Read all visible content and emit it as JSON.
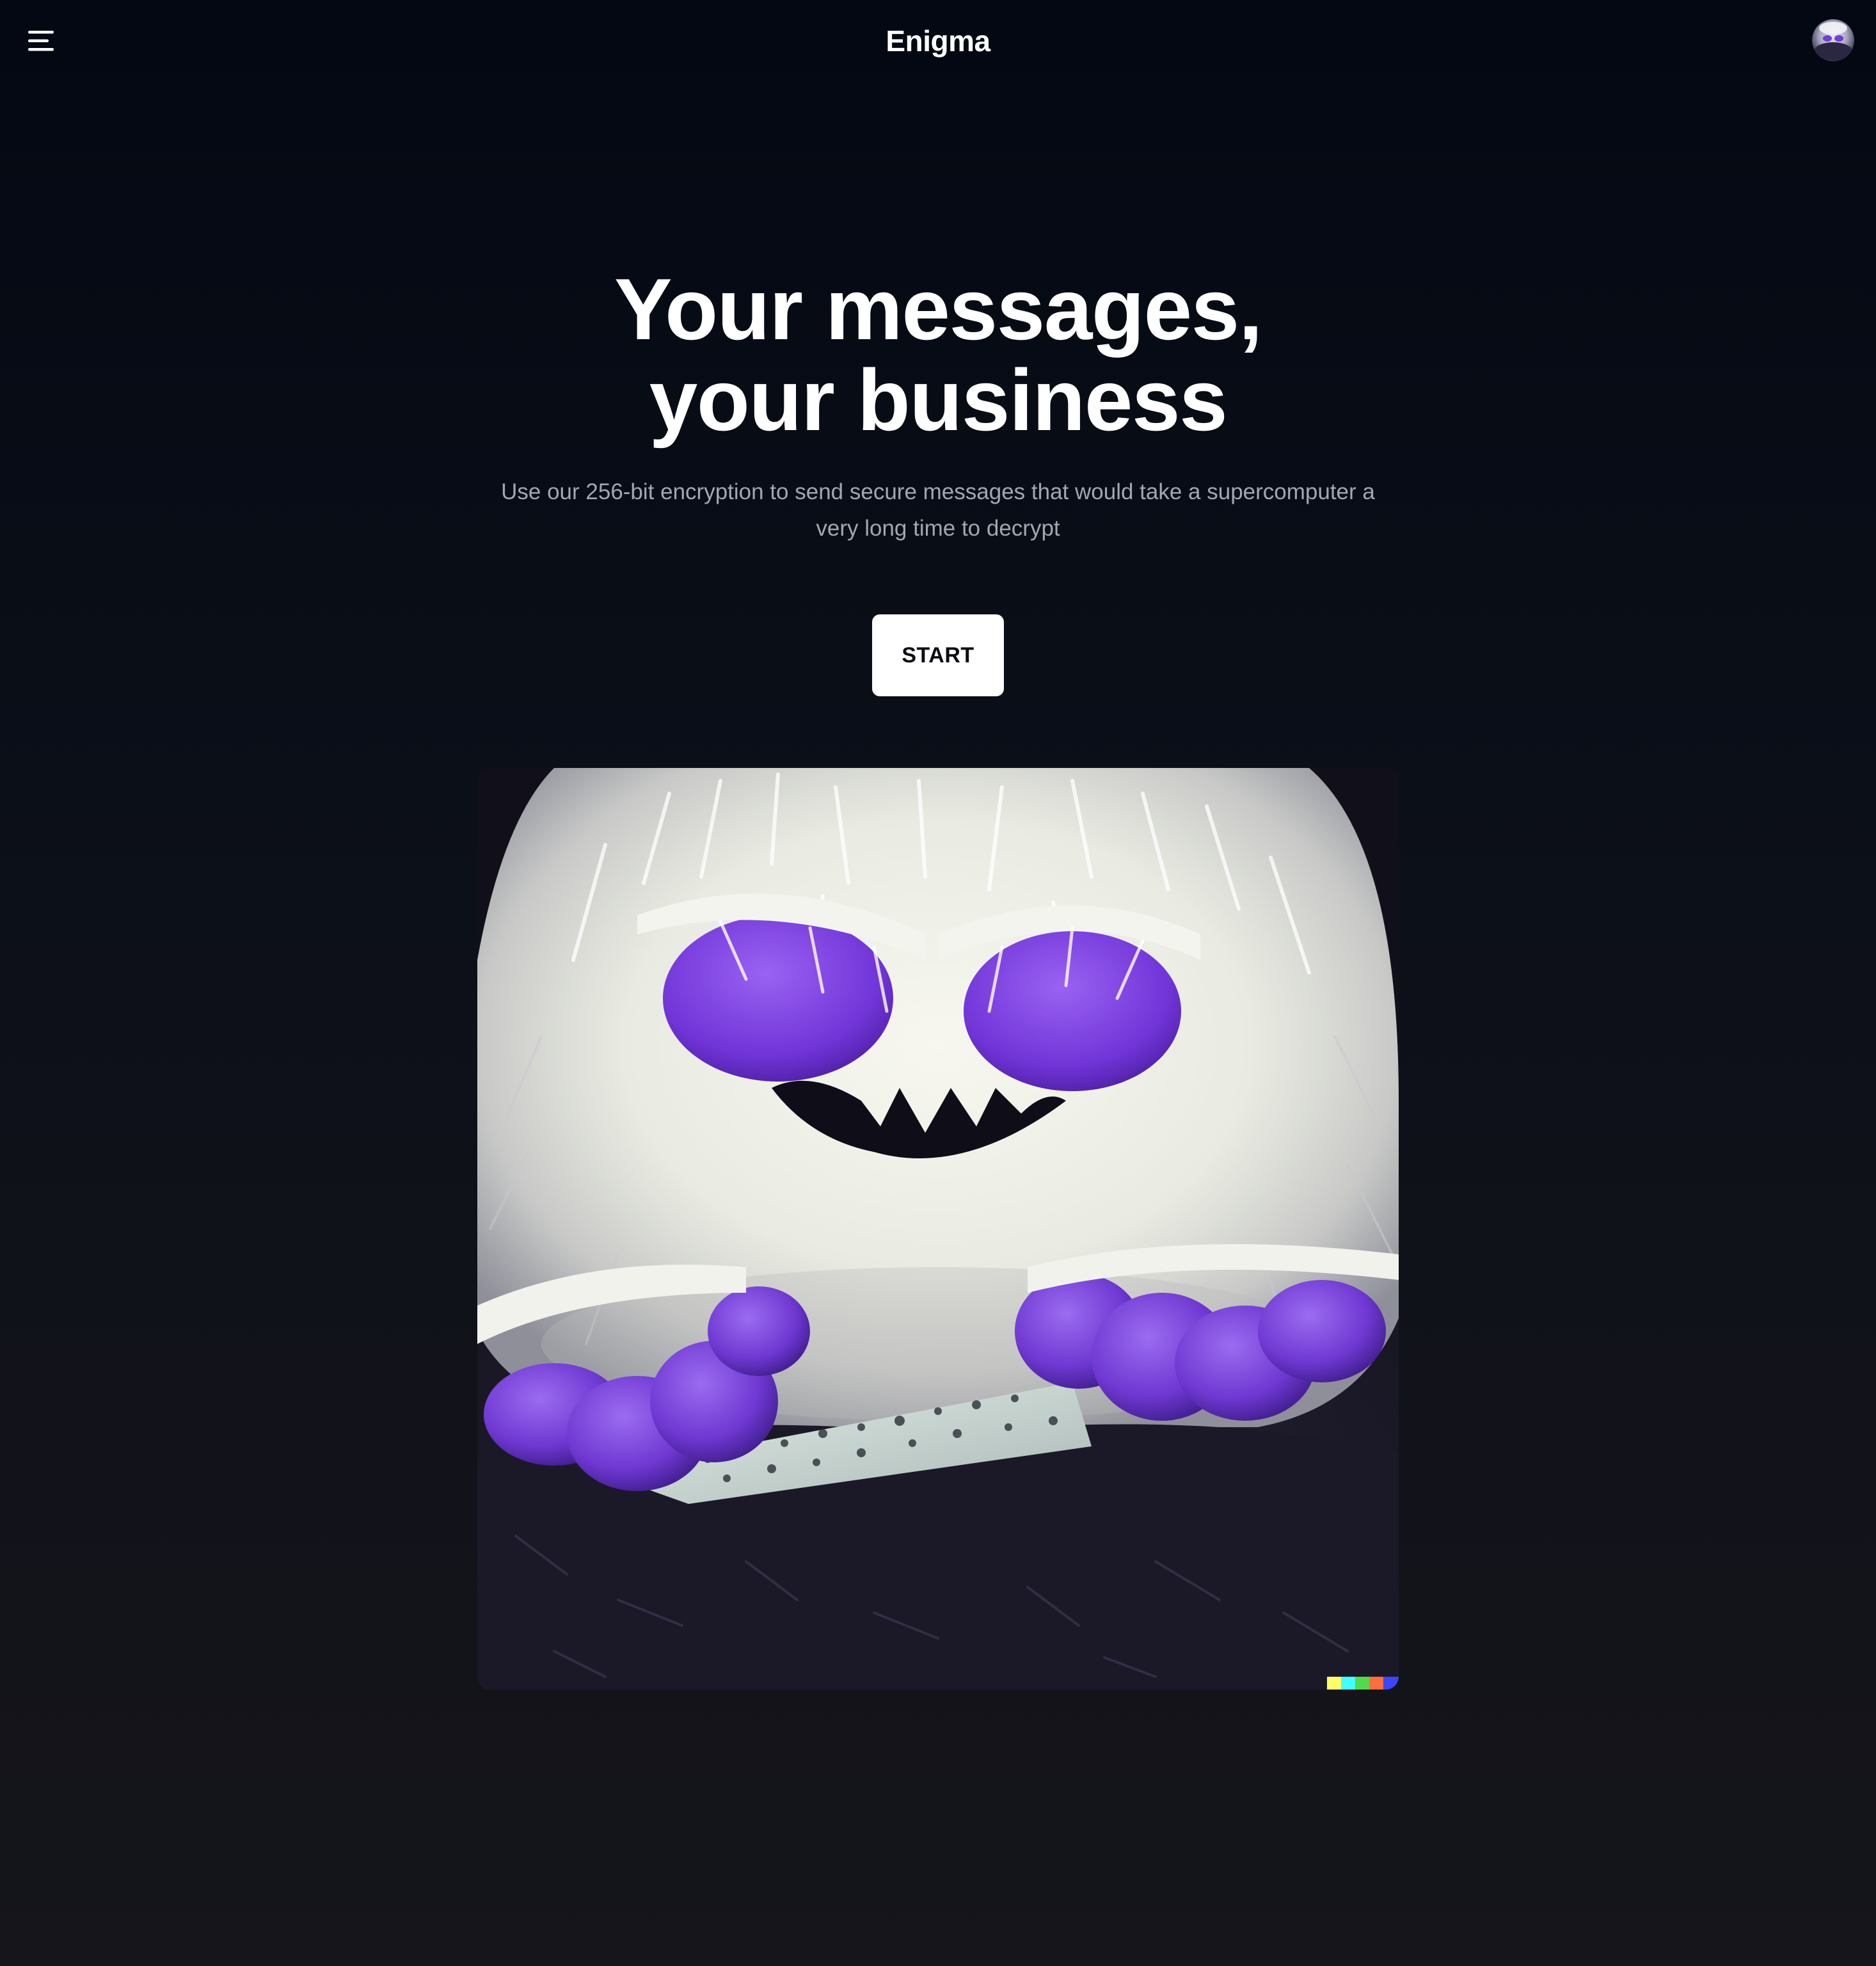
{
  "header": {
    "brand": "Enigma",
    "menu_icon": "hamburger-menu-icon",
    "avatar_icon": "user-avatar-icon"
  },
  "hero": {
    "title_line1": "Your messages,",
    "title_line2": "your business",
    "subtitle": "Use our 256-bit encryption to send secure messages that would take a supercomputer a very long time to decrypt",
    "cta_label": "START"
  },
  "illustration": {
    "subject": "fluffy white monster with purple eyes and paws holding a paper",
    "signature_colors": [
      "#ffff66",
      "#42ffff",
      "#51da4c",
      "#ff6e3c",
      "#3c46ff"
    ]
  },
  "colors": {
    "background": "#070b14",
    "text": "#ffffff",
    "subtitle": "#a4a7b0",
    "button_bg": "#ffffff",
    "button_text": "#0a0c12",
    "accent_purple": "#7b3fe0"
  }
}
